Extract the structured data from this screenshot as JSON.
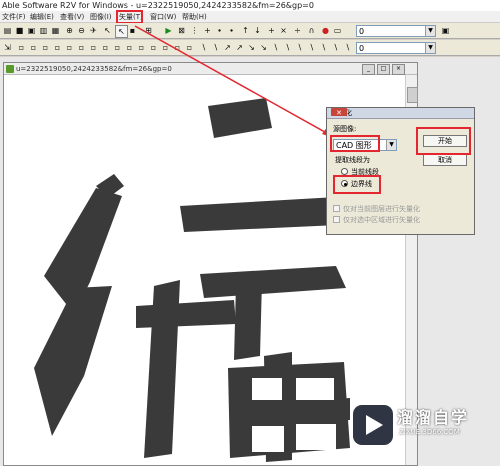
{
  "window": {
    "title": "Able Software R2V for Windows - u=2322519050,2424233582&fm=26&gp=0"
  },
  "menu": [
    "文件(F)",
    "编辑(E)",
    "查看(V)",
    "图像(I)",
    "矢量(T)",
    "窗口(W)",
    "帮助(H)"
  ],
  "toolbar": {
    "layer_combo": "0",
    "layer_combo2": "0"
  },
  "document": {
    "title": "u=2322519050,2424233582&fm=26&gp=0"
  },
  "dialog": {
    "title": "矢量化",
    "source_label": "源图像:",
    "source_value": "CAD 图形",
    "start_button": "开始",
    "cancel_button": "取消",
    "extract_group": "提取线段为",
    "option_center": "当前线段",
    "option_boundary": "边界线",
    "checkbox1": "仅对当前图层进行矢量化",
    "checkbox2": "仅对选中区域进行矢量化"
  },
  "watermark": {
    "brand": "溜溜自学",
    "url": "ZIXUE.3D66.COM"
  },
  "colors": {
    "highlight": "#e3262f",
    "glyph": "#3a3a3a"
  }
}
